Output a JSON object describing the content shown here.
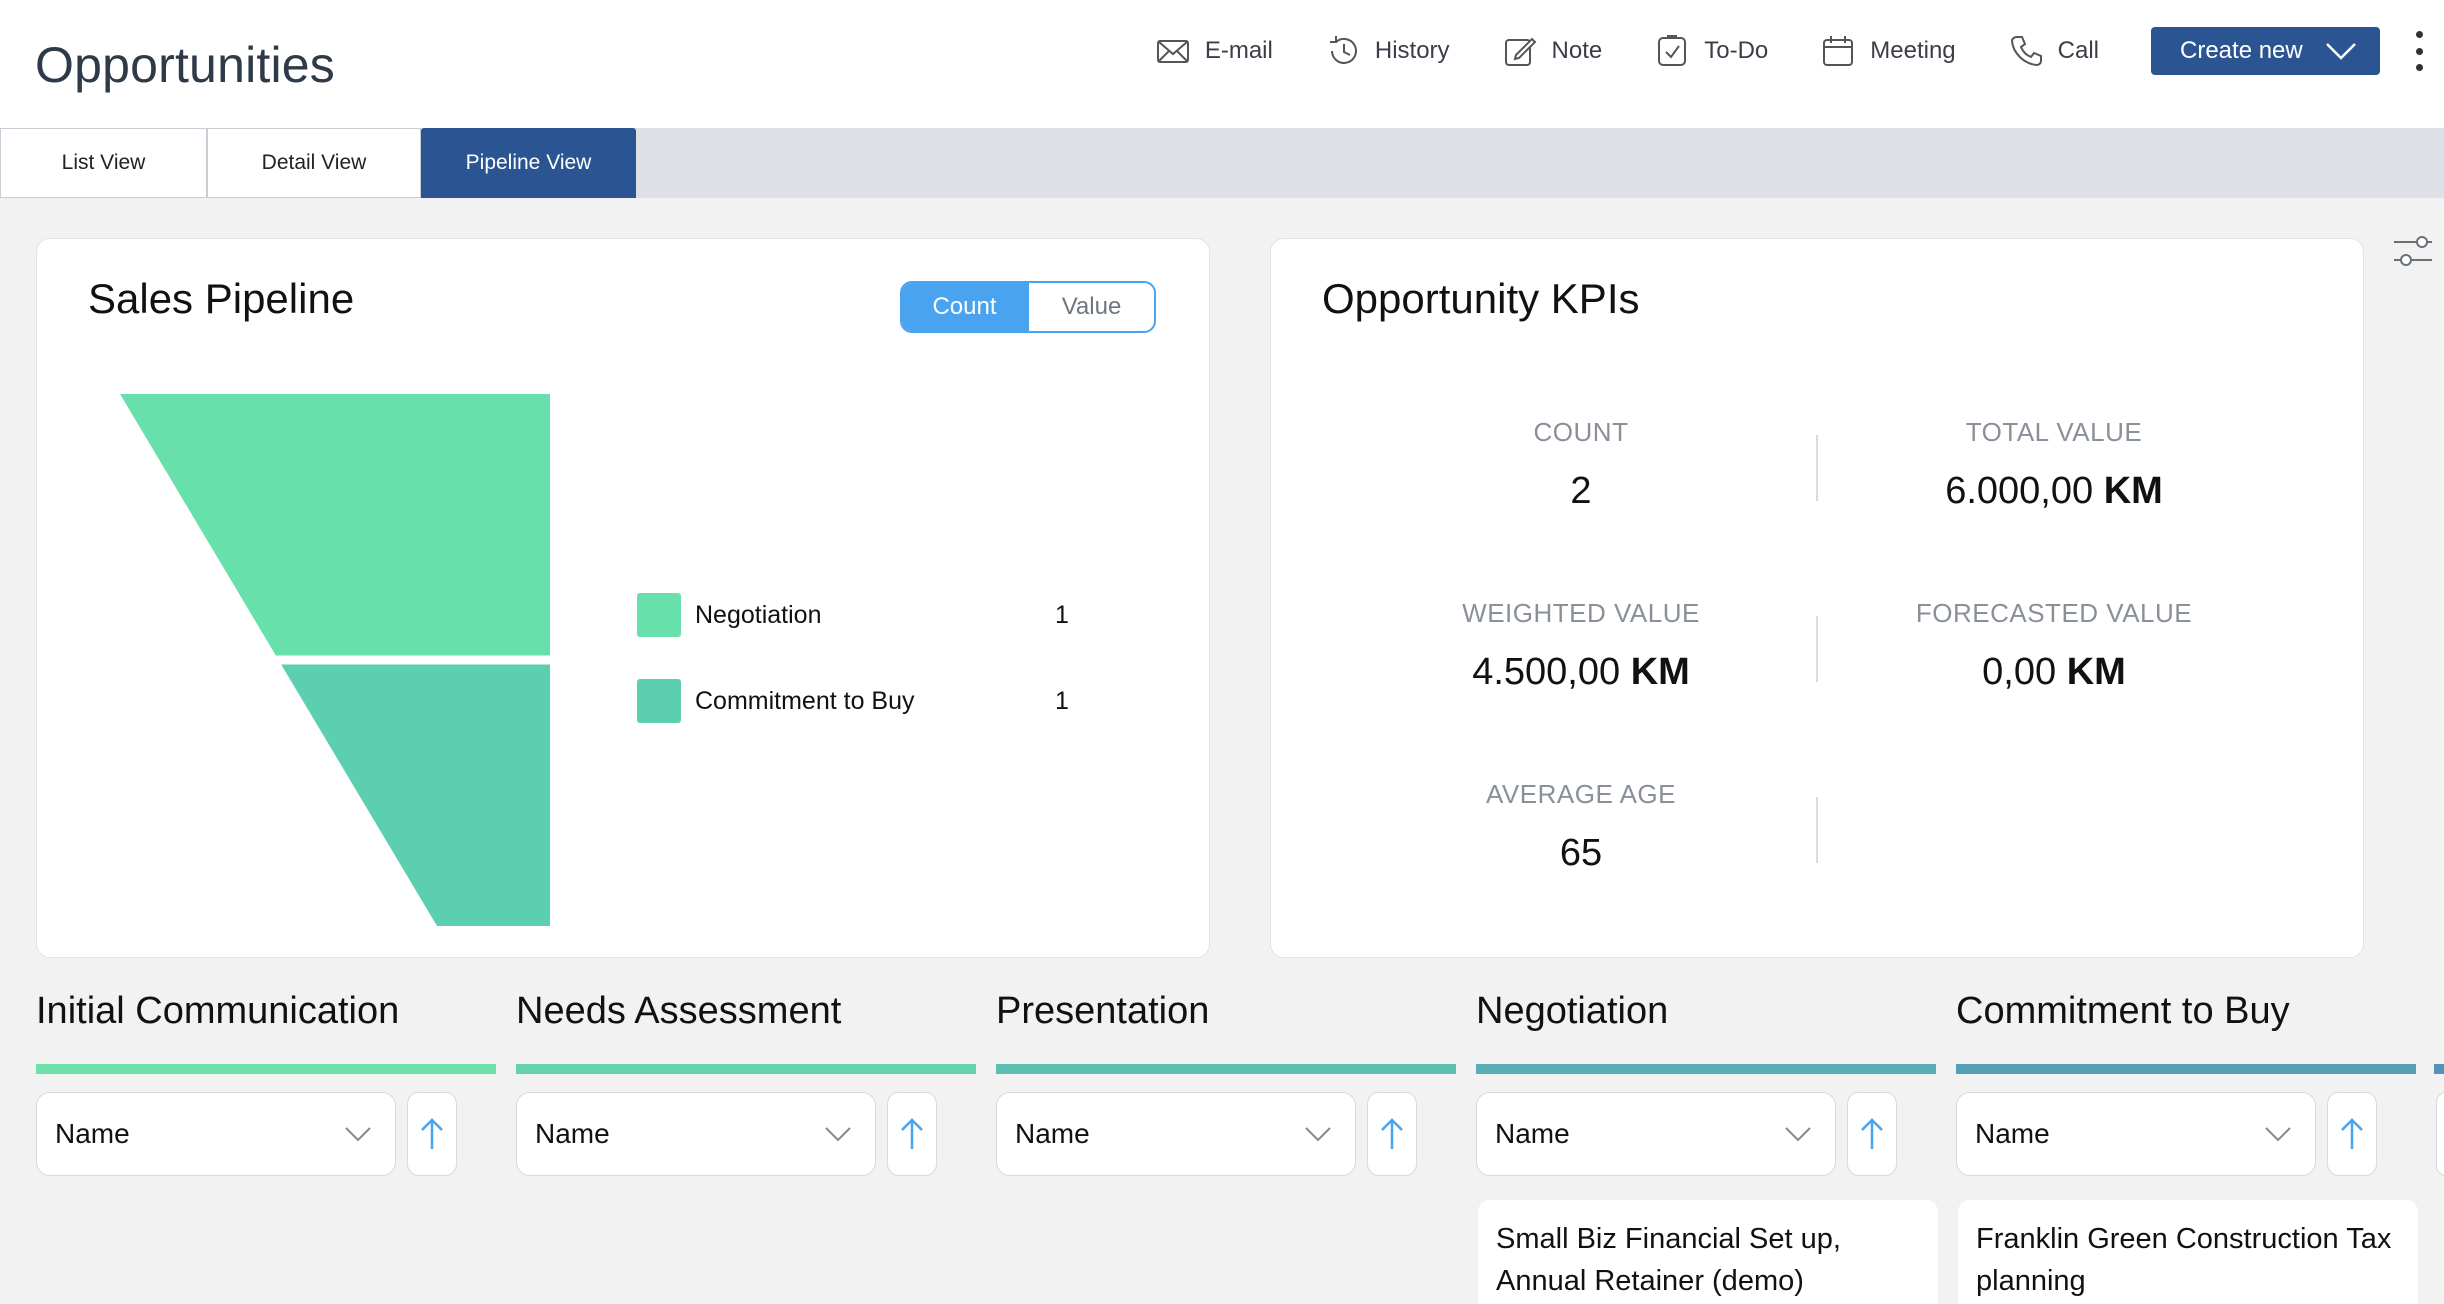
{
  "page": {
    "title": "Opportunities"
  },
  "toolbar": {
    "actions": [
      {
        "label": "E-mail",
        "icon": "envelope-icon"
      },
      {
        "label": "History",
        "icon": "history-icon"
      },
      {
        "label": "Note",
        "icon": "note-icon"
      },
      {
        "label": "To-Do",
        "icon": "checkbox-icon"
      },
      {
        "label": "Meeting",
        "icon": "calendar-icon"
      },
      {
        "label": "Call",
        "icon": "phone-icon"
      }
    ],
    "create_label": "Create new"
  },
  "tabs": [
    {
      "label": "List View"
    },
    {
      "label": "Detail View"
    },
    {
      "label": "Pipeline View",
      "active": true
    }
  ],
  "sales_pipeline": {
    "title": "Sales Pipeline",
    "toggle": {
      "count": "Count",
      "value": "Value",
      "selected": "Count"
    },
    "legend": [
      {
        "name": "Negotiation",
        "count": "1",
        "color": "#67e0ab"
      },
      {
        "name": "Commitment to Buy",
        "count": "1",
        "color": "#5dcfb1"
      }
    ]
  },
  "chart_data": {
    "type": "funnel",
    "categories": [
      "Negotiation",
      "Commitment to Buy"
    ],
    "values": [
      1,
      1
    ],
    "colors": [
      "#67e0ab",
      "#5dcfb1"
    ],
    "title": "Sales Pipeline"
  },
  "kpis": {
    "title": "Opportunity KPIs",
    "count": {
      "label": "COUNT",
      "value": "2"
    },
    "total_value": {
      "label": "TOTAL VALUE",
      "value": "6.000,00",
      "unit": "KM"
    },
    "weighted_value": {
      "label": "WEIGHTED VALUE",
      "value": "4.500,00",
      "unit": "KM"
    },
    "forecasted_value": {
      "label": "FORECASTED VALUE",
      "value": "0,00",
      "unit": "KM"
    },
    "average_age": {
      "label": "AVERAGE AGE",
      "value": "65"
    }
  },
  "stages": [
    {
      "title": "Initial Communication",
      "color": "#6ee0aa",
      "sort": "Name",
      "cards": []
    },
    {
      "title": "Needs Assessment",
      "color": "#64d2ad",
      "sort": "Name",
      "cards": []
    },
    {
      "title": "Presentation",
      "color": "#5dbfb0",
      "sort": "Name",
      "cards": []
    },
    {
      "title": "Negotiation",
      "color": "#58aeb4",
      "sort": "Name",
      "cards": [
        "Small Biz Financial Set up, Annual Retainer (demo)"
      ]
    },
    {
      "title": "Commitment to Buy",
      "color": "#56a0b7",
      "sort": "Name",
      "cards": [
        "Franklin Green Construction Tax planning"
      ]
    }
  ]
}
